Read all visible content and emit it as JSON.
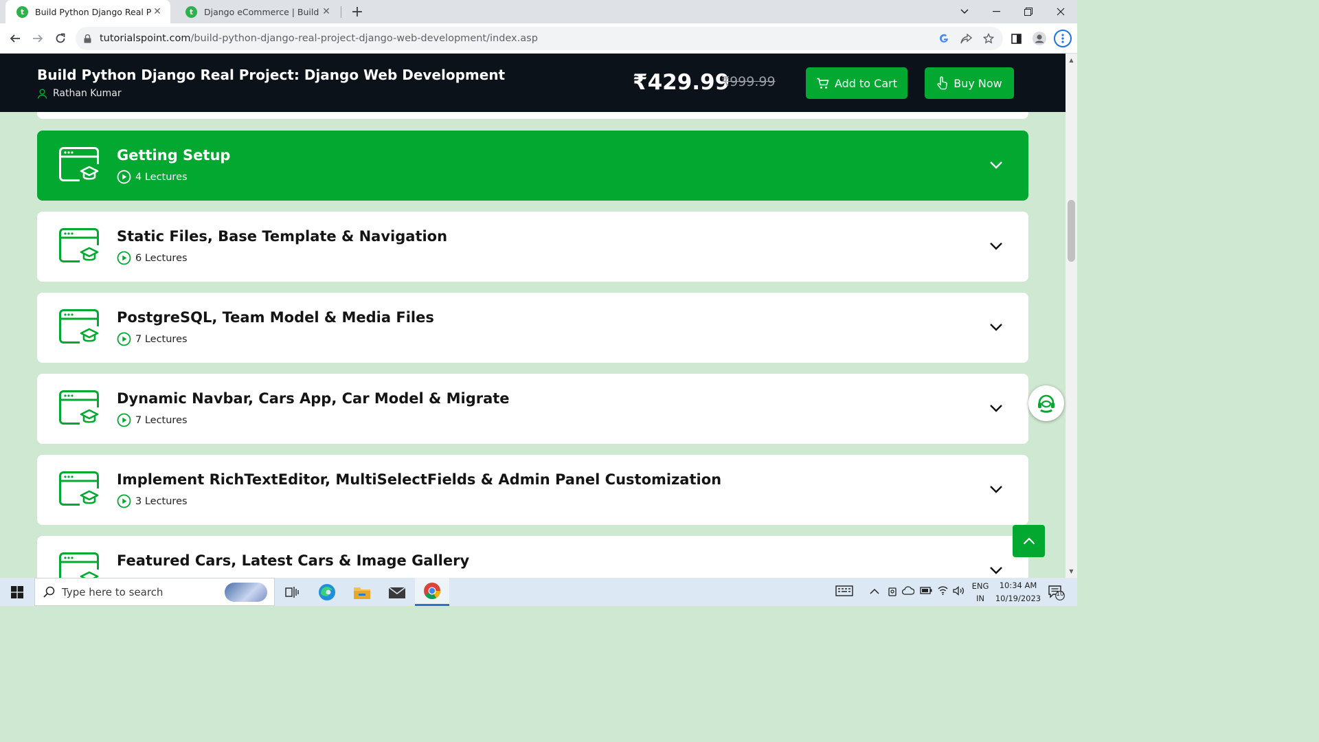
{
  "browser": {
    "tabs": [
      {
        "title": "Build Python Django Real Projec",
        "close": "✕"
      },
      {
        "title": "Django eCommerce | Build Adva",
        "close": "✕"
      }
    ],
    "new_tab": "+",
    "url_domain": "tutorialspoint.com",
    "url_path": "/build-python-django-real-project-django-web-development/index.asp"
  },
  "course_header": {
    "title": "Build Python Django Real Project: Django Web Development",
    "author": "Rathan Kumar",
    "price": "₹429.99",
    "old_price": "₹999.99",
    "add_to_cart": "Add to Cart",
    "buy_now": "Buy Now"
  },
  "sections": [
    {
      "title": "Getting Setup",
      "lectures": "4 Lectures"
    },
    {
      "title": "Static Files, Base Template & Navigation",
      "lectures": "6 Lectures"
    },
    {
      "title": "PostgreSQL, Team Model & Media Files",
      "lectures": "7 Lectures"
    },
    {
      "title": "Dynamic Navbar, Cars App, Car Model & Migrate",
      "lectures": "7 Lectures"
    },
    {
      "title": "Implement RichTextEditor, MultiSelectFields & Admin Panel Customization",
      "lectures": "3 Lectures"
    },
    {
      "title": "Featured Cars, Latest Cars & Image Gallery",
      "lectures": ""
    }
  ],
  "colors": {
    "brand_green": "#03a831",
    "header_bg": "#0c1219",
    "page_bg": "#cfe8d1"
  },
  "taskbar": {
    "search_placeholder": "Type here to search",
    "lang_top": "ENG",
    "lang_bottom": "IN",
    "time": "10:34 AM",
    "date": "10/19/2023",
    "notifications": "10"
  }
}
